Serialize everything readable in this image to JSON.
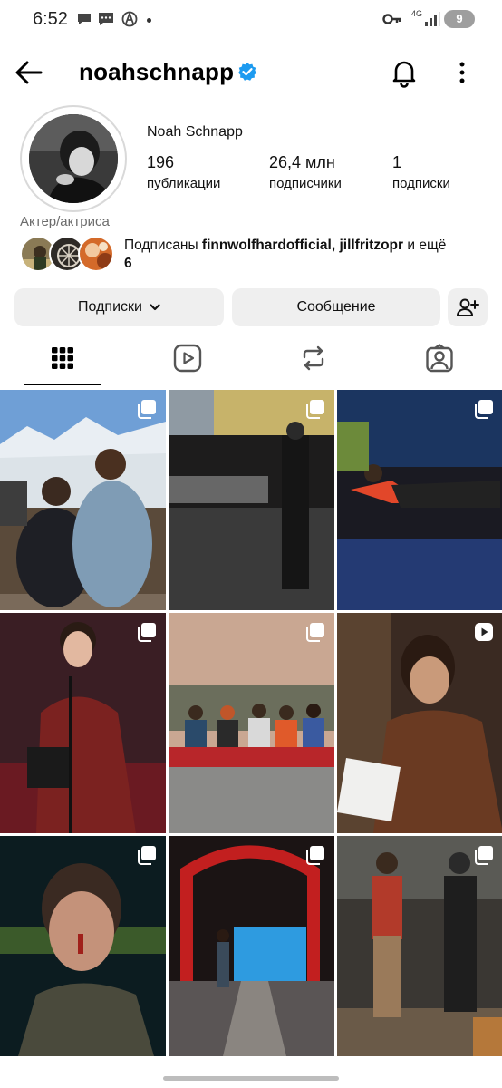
{
  "status_bar": {
    "time": "6:52",
    "network": "4G",
    "battery": "9"
  },
  "header": {
    "username": "noahschnapp",
    "verified": true
  },
  "profile": {
    "full_name": "Noah Schnapp",
    "stats": [
      {
        "value": "196",
        "label": "публикации"
      },
      {
        "value": "26,4 млн",
        "label": "подписчики"
      },
      {
        "value": "1",
        "label": "подписки"
      }
    ],
    "category": "Актер/актриса",
    "mutual": {
      "prefix": "Подписаны ",
      "accounts": "finnwolfhardofficial, jillfritzopr",
      "suffix_before": " и ещё",
      "count": "6"
    }
  },
  "actions": {
    "follow_label": "Подписки",
    "message_label": "Сообщение"
  },
  "tabs": [
    {
      "icon": "grid-icon",
      "selected": true
    },
    {
      "icon": "reels-icon",
      "selected": false
    },
    {
      "icon": "reposts-icon",
      "selected": false
    },
    {
      "icon": "tagged-icon",
      "selected": false
    }
  ],
  "posts": [
    {
      "type": "carousel"
    },
    {
      "type": "carousel"
    },
    {
      "type": "carousel"
    },
    {
      "type": "carousel"
    },
    {
      "type": "carousel"
    },
    {
      "type": "reel"
    },
    {
      "type": "carousel"
    },
    {
      "type": "carousel"
    },
    {
      "type": "carousel"
    }
  ]
}
